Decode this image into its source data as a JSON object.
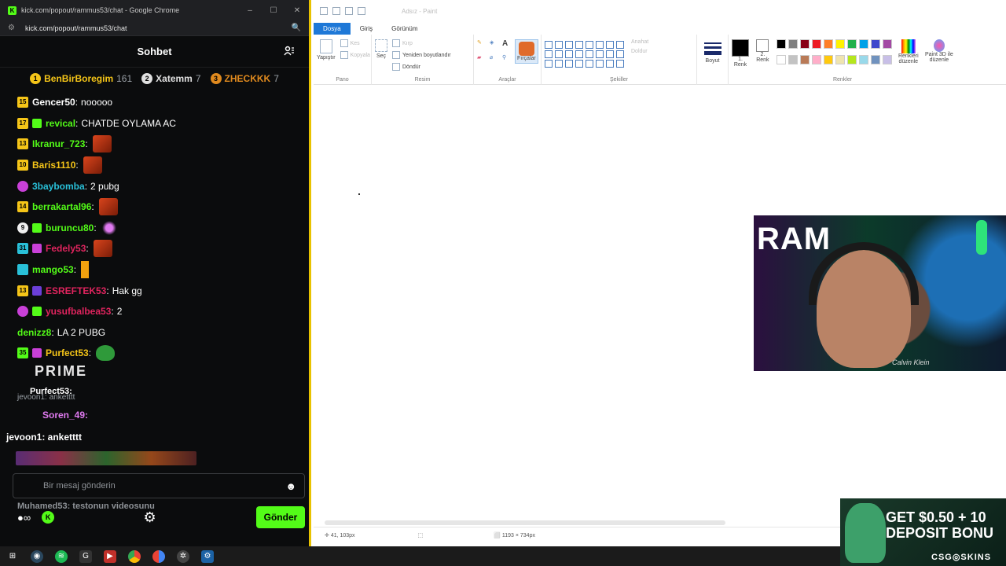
{
  "chrome": {
    "window_title": "kick.com/popout/rammus53/chat - Google Chrome",
    "url": "kick.com/popout/rammus53/chat"
  },
  "chat": {
    "header_title": "Sohbet",
    "leaderboard": [
      {
        "rank": "1",
        "name": "BenBirBoregim",
        "count": "161",
        "color": "#f5c518"
      },
      {
        "rank": "2",
        "name": "Xatemm",
        "count": "7",
        "color": "#e0e0e0"
      },
      {
        "rank": "3",
        "name": "ZHECKKK",
        "count": "7",
        "color": "#e08a1e"
      }
    ],
    "messages": [
      {
        "badge": "15",
        "badge_class": "b-yellow",
        "user": "Gencer50",
        "color": "#ffffff",
        "text": "nooooo",
        "emote": ""
      },
      {
        "badge": "17",
        "badge_class": "b-yellow",
        "user": "revical",
        "color": "#53fc18",
        "text": "CHATDE OYLAMA AC",
        "emote": "",
        "extra": "#53fc18"
      },
      {
        "badge": "13",
        "badge_class": "b-yellow",
        "user": "Ikranur_723",
        "color": "#53fc18",
        "text": "",
        "emote": "emote"
      },
      {
        "badge": "10",
        "badge_class": "b-yellow",
        "user": "Baris1110",
        "color": "#f5c518",
        "text": "",
        "emote": "emote"
      },
      {
        "badge": "",
        "badge_class": "b-pink",
        "user": "3baybomba",
        "color": "#29c0d8",
        "text": "2 pubg",
        "emote": ""
      },
      {
        "badge": "14",
        "badge_class": "b-yellow",
        "user": "berrakartal96",
        "color": "#53fc18",
        "text": "",
        "emote": "emote"
      },
      {
        "badge": "9",
        "badge_class": "b-white",
        "user": "buruncu80",
        "color": "#53fc18",
        "text": "",
        "emote": "emote-purple",
        "extra": "#53fc18"
      },
      {
        "badge": "31",
        "badge_class": "b-teal",
        "user": "Fedely53",
        "color": "#e0245e",
        "text": "",
        "emote": "emote",
        "extra": "#c940d8"
      },
      {
        "badge": "",
        "badge_class": "b-teal",
        "user": "mango53",
        "color": "#53fc18",
        "text": "",
        "emote": "emote-orange"
      },
      {
        "badge": "13",
        "badge_class": "b-yellow",
        "user": "ESREFTEK53",
        "color": "#e0245e",
        "text": "Hak gg",
        "emote": "",
        "extra": "#6b3fd8"
      },
      {
        "badge": "",
        "badge_class": "b-pink",
        "user": "yusufbalbea53",
        "color": "#e0245e",
        "text": "2",
        "emote": "",
        "extra": "#53fc18"
      },
      {
        "badge": "",
        "badge_class": "",
        "user": "denizz8",
        "color": "#53fc18",
        "text": "LA 2 PUBG",
        "emote": ""
      },
      {
        "badge": "35",
        "badge_class": "b-green",
        "user": "Purfect53",
        "color": "#f5c518",
        "text": "",
        "emote": "emote-frog",
        "extra": "#c940d8"
      }
    ],
    "overlay_prime": "PRIME",
    "overlay_lines": [
      {
        "text": "Purfect53:",
        "color": "#ffffff"
      },
      {
        "text": "jevoon1: anketttt",
        "color": "#9aa0a6"
      },
      {
        "text": "Soren_49:",
        "color": "#e07af0"
      },
      {
        "text": "jevoon1: anketttt",
        "color": "#ffffff"
      },
      {
        "text": "Muhamed53: testonun videosunu",
        "color": "#8e9297"
      }
    ],
    "input_placeholder": "Bir mesaj gönderin",
    "send_label": "Gönder"
  },
  "paint": {
    "window_title": "Adsız - Paint",
    "tabs": [
      "Dosya",
      "Giriş",
      "Görünüm"
    ],
    "clipboard": {
      "paste": "Yapıştır",
      "cut": "Kes",
      "copy": "Kopyala",
      "label": "Pano"
    },
    "image": {
      "select": "Seç",
      "crop": "Kırp",
      "resize": "Yeniden boyutlandır",
      "rotate": "Döndür",
      "label": "Resim"
    },
    "tools": {
      "brushes": "Fırçalar",
      "label": "Araçlar"
    },
    "shapes": {
      "outline": "Anahat",
      "fill": "Doldur",
      "label": "Şekiller"
    },
    "size_label": "Boyut",
    "colors": {
      "color1": "1. Renk",
      "color2": "2. Renk",
      "edit": "Renkleri düzenle",
      "paint3d": "Paint 3D ile düzenle",
      "label": "Renkler",
      "palette": [
        "#000000",
        "#7f7f7f",
        "#880015",
        "#ed1c24",
        "#ff7f27",
        "#fff200",
        "#22b14c",
        "#00a2e8",
        "#3f48cc",
        "#a349a4",
        "#ffffff",
        "#c3c3c3",
        "#b97a57",
        "#ffaec9",
        "#ffc90e",
        "#efe4b0",
        "#b5e61d",
        "#99d9ea",
        "#7092be",
        "#c8bfe7"
      ]
    },
    "status": {
      "cursor": "41, 103px",
      "image_size": "1193 × 734px"
    }
  },
  "webcam": {
    "overlay_text": "RAM",
    "shirt_text": "Calvin Klein"
  },
  "ad": {
    "line1": "GET $0.50 + 10",
    "line2": "DEPOSIT BONU",
    "brand": "CSG◎SKINS"
  }
}
